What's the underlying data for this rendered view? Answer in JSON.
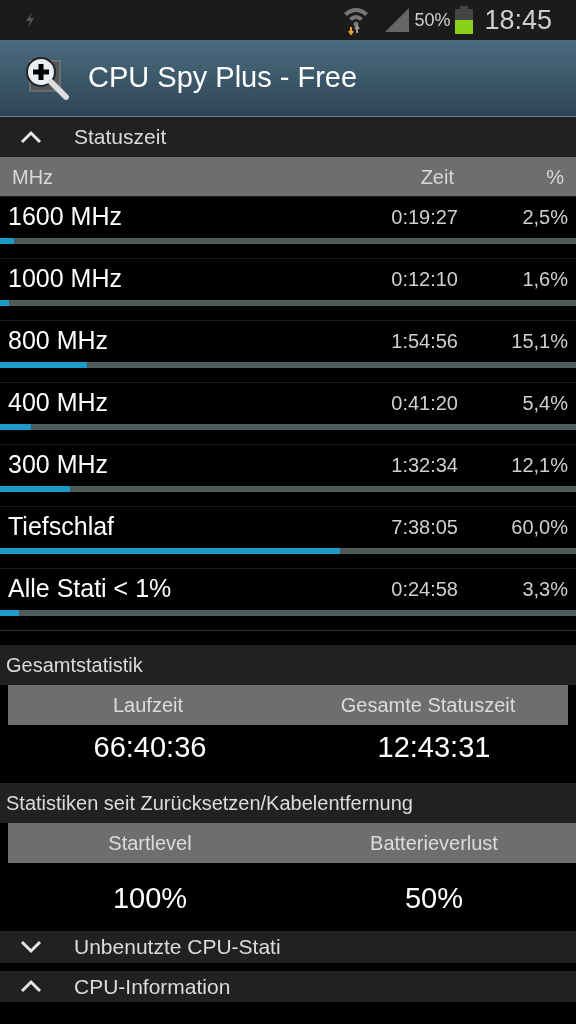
{
  "status_bar": {
    "battery": "50%",
    "time": "18:45"
  },
  "app_bar": {
    "title": "CPU Spy Plus - Free"
  },
  "state_section": {
    "title": "Statuszeit",
    "expanded": true,
    "columns": [
      "MHz",
      "Zeit",
      "%"
    ],
    "rows": [
      {
        "name": "1600 MHz",
        "time": "0:19:27",
        "percent": "2,5%",
        "level": 0.025
      },
      {
        "name": "1000 MHz",
        "time": "0:12:10",
        "percent": "1,6%",
        "level": 0.016
      },
      {
        "name": "800 MHz",
        "time": "1:54:56",
        "percent": "15,1%",
        "level": 0.151
      },
      {
        "name": "400 MHz",
        "time": "0:41:20",
        "percent": "5,4%",
        "level": 0.054
      },
      {
        "name": "300 MHz",
        "time": "1:32:34",
        "percent": "12,1%",
        "level": 0.121
      },
      {
        "name": "Tiefschlaf",
        "time": "7:38:05",
        "percent": "60,0%",
        "level": 0.59
      },
      {
        "name": "Alle Stati < 1%",
        "time": "0:24:58",
        "percent": "3,3%",
        "level": 0.033
      }
    ]
  },
  "stat_groups": [
    {
      "title": "Gesamtstatistik",
      "columns": [
        "Laufzeit",
        "Gesamte Statuszeit"
      ],
      "values": [
        "66:40:36",
        "12:43:31"
      ]
    },
    {
      "title": "Statistiken seit Zurücksetzen/Kabelentfernung",
      "columns": [
        "Startlevel",
        "Batterieverlust"
      ],
      "values": [
        "100%",
        "50%"
      ]
    }
  ],
  "collapsible_sections": [
    {
      "title": "Unbenutzte CPU-Stati",
      "expanded": false
    },
    {
      "title": "CPU-Information",
      "expanded": true
    }
  ]
}
